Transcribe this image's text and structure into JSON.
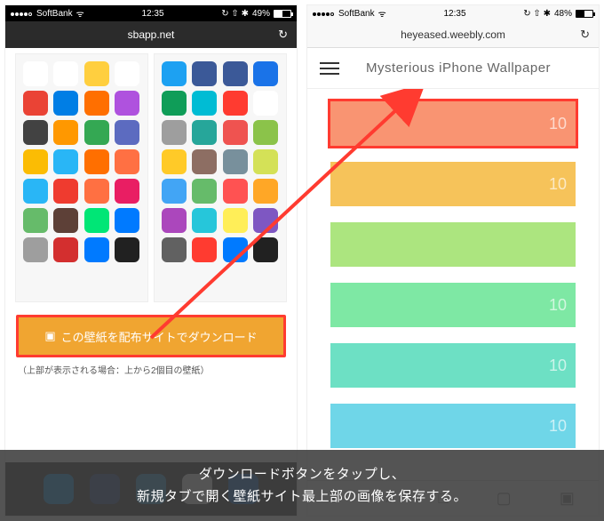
{
  "left": {
    "status": {
      "carrier": "SoftBank",
      "wifi": "᯾",
      "time": "12:35",
      "icons": "⟳ ✈︎ ⚡︎",
      "battery_pct": "49%"
    },
    "url": "sbapp.net",
    "download_button": "この壁紙を配布サイトでダウンロード",
    "download_icon": "⬇",
    "note": "（上部が表示される場合：上から2個目の壁紙）",
    "icon_colors": [
      [
        "#fff",
        "#fff",
        "#ffcf3f",
        "#fff",
        "#1da1f2",
        "#3b5998",
        "#3b5998",
        "#1a73e8"
      ],
      [
        "#ea4335",
        "#007ee5",
        "#ff6f00",
        "#af52de",
        "#0f9d58",
        "#00bcd4",
        "#ff3b30",
        "#fff"
      ],
      [
        "#424242",
        "#ff9800",
        "#34a853",
        "#5c6bc0",
        "#9e9e9e",
        "#26a69a",
        "#ef5350",
        "#8bc34a"
      ],
      [
        "#fbbc04",
        "#29b6f6",
        "#ff6f00",
        "#ff7043",
        "#ffca28",
        "#8d6e63",
        "#78909c",
        "#d4e157"
      ],
      [
        "#29b6f6",
        "#ef3b2f",
        "#ff7042",
        "#e91e63",
        "#42a5f5",
        "#66bb6a",
        "#ff5252",
        "#ffa726"
      ],
      [
        "#66bb6a",
        "#5d4037",
        "#00e676",
        "#007aff",
        "#ab47bc",
        "#26c6da",
        "#ffee58",
        "#7e57c2"
      ],
      [
        "#9e9e9e",
        "#d32f2f",
        "#007aff",
        "#212121",
        "#616161",
        "#ff3b30",
        "#007aff",
        "#212121"
      ]
    ],
    "dock_colors": [
      "#1da1f2",
      "#3b5998",
      "#38a1db",
      "#ffffff",
      "#1976d2"
    ]
  },
  "right": {
    "status": {
      "carrier": "SoftBank",
      "time": "12:35",
      "battery_pct": "48%"
    },
    "url": "heyeased.weebly.com",
    "title": "Mysterious iPhone Wallpaper",
    "swatches": [
      {
        "color": "#f99472",
        "label": "10",
        "selected": true
      },
      {
        "color": "#f6c35a",
        "label": "10"
      },
      {
        "color": "#ace57f",
        "label": ""
      },
      {
        "color": "#7ee8a4",
        "label": "10"
      },
      {
        "color": "#6de0c4",
        "label": "10"
      },
      {
        "color": "#6fd6e8",
        "label": "10"
      }
    ],
    "toolbar": {
      "back": "‹",
      "fwd": "›",
      "share": "□",
      "book": "▢",
      "tabs": "▣"
    }
  },
  "caption": {
    "line1": "ダウンロードボタンをタップし、",
    "line2": "新規タブで開く壁紙サイト最上部の画像を保存する。"
  }
}
